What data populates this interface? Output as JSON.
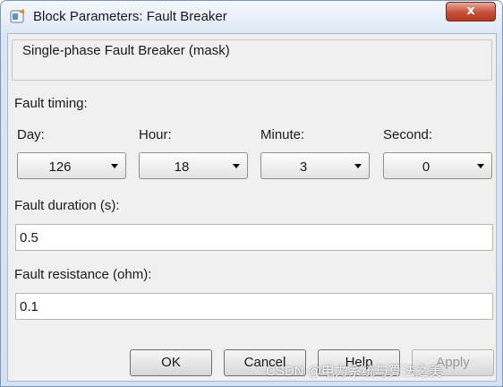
{
  "window": {
    "title": "Block Parameters: Fault Breaker",
    "close_glyph": "x"
  },
  "mask": {
    "title": "Single-phase Fault Breaker (mask)"
  },
  "fault_timing": {
    "label": "Fault timing:",
    "fields": [
      {
        "label": "Day:",
        "value": "126"
      },
      {
        "label": "Hour:",
        "value": "18"
      },
      {
        "label": "Minute:",
        "value": "3"
      },
      {
        "label": "Second:",
        "value": "0"
      }
    ]
  },
  "fault_duration": {
    "label": "Fault duration (s):",
    "value": "0.5"
  },
  "fault_resistance": {
    "label": "Fault resistance (ohm):",
    "value": "0.1"
  },
  "buttons": {
    "ok": "OK",
    "cancel": "Cancel",
    "help": "Help",
    "apply": "Apply"
  },
  "watermark": "CSDN @电力系统与算法之美",
  "icons": {
    "app": "simulink-block-icon",
    "close": "close-icon",
    "dropdown": "chevron-down-icon"
  }
}
